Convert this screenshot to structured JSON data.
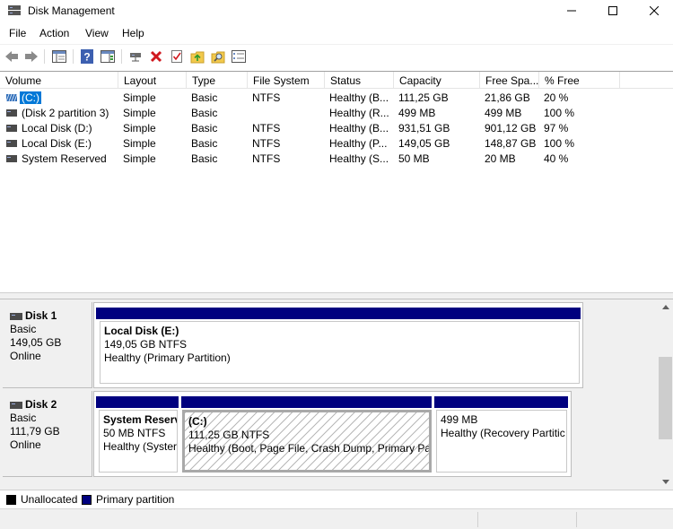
{
  "window": {
    "title": "Disk Management",
    "icon": "disk-management-icon",
    "controls": [
      "minimize-icon",
      "maximize-icon",
      "close-icon"
    ]
  },
  "menu": [
    "File",
    "Action",
    "View",
    "Help"
  ],
  "toolbar": [
    "back-arrow-icon",
    "forward-arrow-icon",
    "show-hide-console-tree-icon",
    "help-icon",
    "show-hide-action-pane-icon",
    "connect-disk-icon",
    "delete-icon",
    "properties-checklist-icon",
    "import-folder-icon",
    "find-folder-icon",
    "disk-list-icon"
  ],
  "volume_list": {
    "columns": [
      "Volume",
      "Layout",
      "Type",
      "File System",
      "Status",
      "Capacity",
      "Free Spa...",
      "% Free"
    ],
    "rows": [
      {
        "volume": "(C:)",
        "layout": "Simple",
        "type": "Basic",
        "fs": "NTFS",
        "status": "Healthy (B...",
        "capacity": "111,25 GB",
        "free": "21,86 GB",
        "pct": "20 %",
        "selected": true,
        "icon": "striped-volume-icon"
      },
      {
        "volume": "(Disk 2 partition 3)",
        "layout": "Simple",
        "type": "Basic",
        "fs": "",
        "status": "Healthy (R...",
        "capacity": "499 MB",
        "free": "499 MB",
        "pct": "100 %",
        "selected": false,
        "icon": "volume-icon"
      },
      {
        "volume": "Local Disk (D:)",
        "layout": "Simple",
        "type": "Basic",
        "fs": "NTFS",
        "status": "Healthy (B...",
        "capacity": "931,51 GB",
        "free": "901,12 GB",
        "pct": "97 %",
        "selected": false,
        "icon": "volume-icon"
      },
      {
        "volume": "Local Disk (E:)",
        "layout": "Simple",
        "type": "Basic",
        "fs": "NTFS",
        "status": "Healthy (P...",
        "capacity": "149,05 GB",
        "free": "148,87 GB",
        "pct": "100 %",
        "selected": false,
        "icon": "volume-icon"
      },
      {
        "volume": "System Reserved",
        "layout": "Simple",
        "type": "Basic",
        "fs": "NTFS",
        "status": "Healthy (S...",
        "capacity": "50 MB",
        "free": "20 MB",
        "pct": "40 %",
        "selected": false,
        "icon": "volume-icon"
      }
    ]
  },
  "disks": [
    {
      "name": "Disk 1",
      "type": "Basic",
      "size": "149,05 GB",
      "state": "Online",
      "partitions": [
        {
          "title": "Local Disk  (E:)",
          "size": "149,05 GB NTFS",
          "status": "Healthy (Primary Partition)"
        }
      ]
    },
    {
      "name": "Disk 2",
      "type": "Basic",
      "size": "111,79 GB",
      "state": "Online",
      "partitions": [
        {
          "title": "System Reserv",
          "size": "50 MB NTFS",
          "status": "Healthy (Syster"
        },
        {
          "title": "(C:)",
          "size": "111,25 GB NTFS",
          "status": "Healthy (Boot, Page File, Crash Dump, Primary Par"
        },
        {
          "title": "",
          "size": "499 MB",
          "status": "Healthy (Recovery Partitic"
        }
      ]
    }
  ],
  "legend": [
    {
      "label": "Unallocated",
      "color": "#000000"
    },
    {
      "label": "Primary partition",
      "color": "#00007f"
    }
  ],
  "colors": {
    "selection": "#0078d7",
    "primary_partition": "#00007f"
  }
}
